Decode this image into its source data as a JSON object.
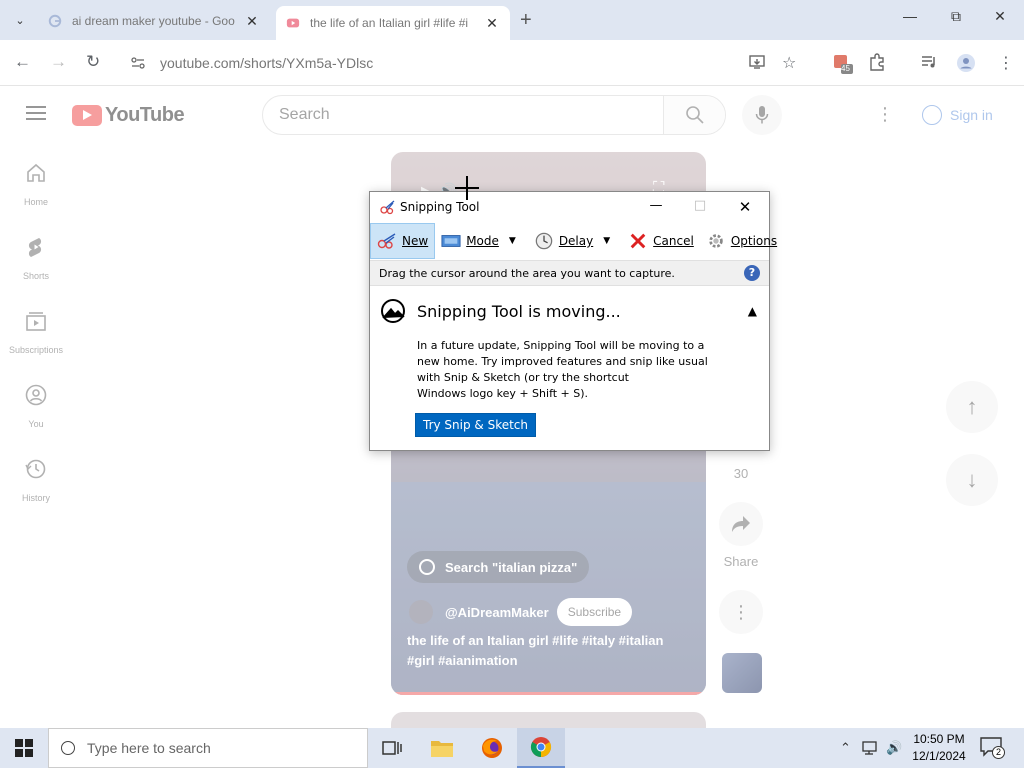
{
  "browser": {
    "tabs": [
      {
        "title": "ai dream maker youtube - Goo"
      },
      {
        "title": "the life of an Italian girl #life #i"
      }
    ],
    "new_tab": "+",
    "url": "youtube.com/shorts/YXm5a-YDlsc",
    "extensions_badge": "45"
  },
  "youtube": {
    "logo_text": "YouTube",
    "search_placeholder": "Search",
    "sign_in": "Sign in",
    "sidebar": [
      {
        "label": "Home"
      },
      {
        "label": "Shorts"
      },
      {
        "label": "Subscriptions"
      },
      {
        "label": "You"
      },
      {
        "label": "History"
      }
    ],
    "short": {
      "search_pill": "Search \"italian pizza\"",
      "channel": "@AiDreamMaker",
      "subscribe": "Subscribe",
      "caption": "the life of an Italian girl #life #italy #italian #girl #aianimation"
    },
    "actions": {
      "comments_count": "30",
      "share": "Share"
    }
  },
  "snipping_tool": {
    "title": "Snipping Tool",
    "toolbar": {
      "new": "New",
      "mode": "Mode",
      "delay": "Delay",
      "cancel": "Cancel",
      "options": "Options"
    },
    "hint": "Drag the cursor around the area you want to capture.",
    "moving_title": "Snipping Tool is moving...",
    "moving_text_1": "In a future update, Snipping Tool will be moving to a new home. Try improved features and snip like usual with Snip & Sketch (or try the shortcut",
    "moving_text_2": "Windows logo key + Shift + S).",
    "try_button": "Try Snip & Sketch"
  },
  "taskbar": {
    "search_placeholder": "Type here to search",
    "time": "10:50 PM",
    "date": "12/1/2024",
    "notifications": "2"
  }
}
